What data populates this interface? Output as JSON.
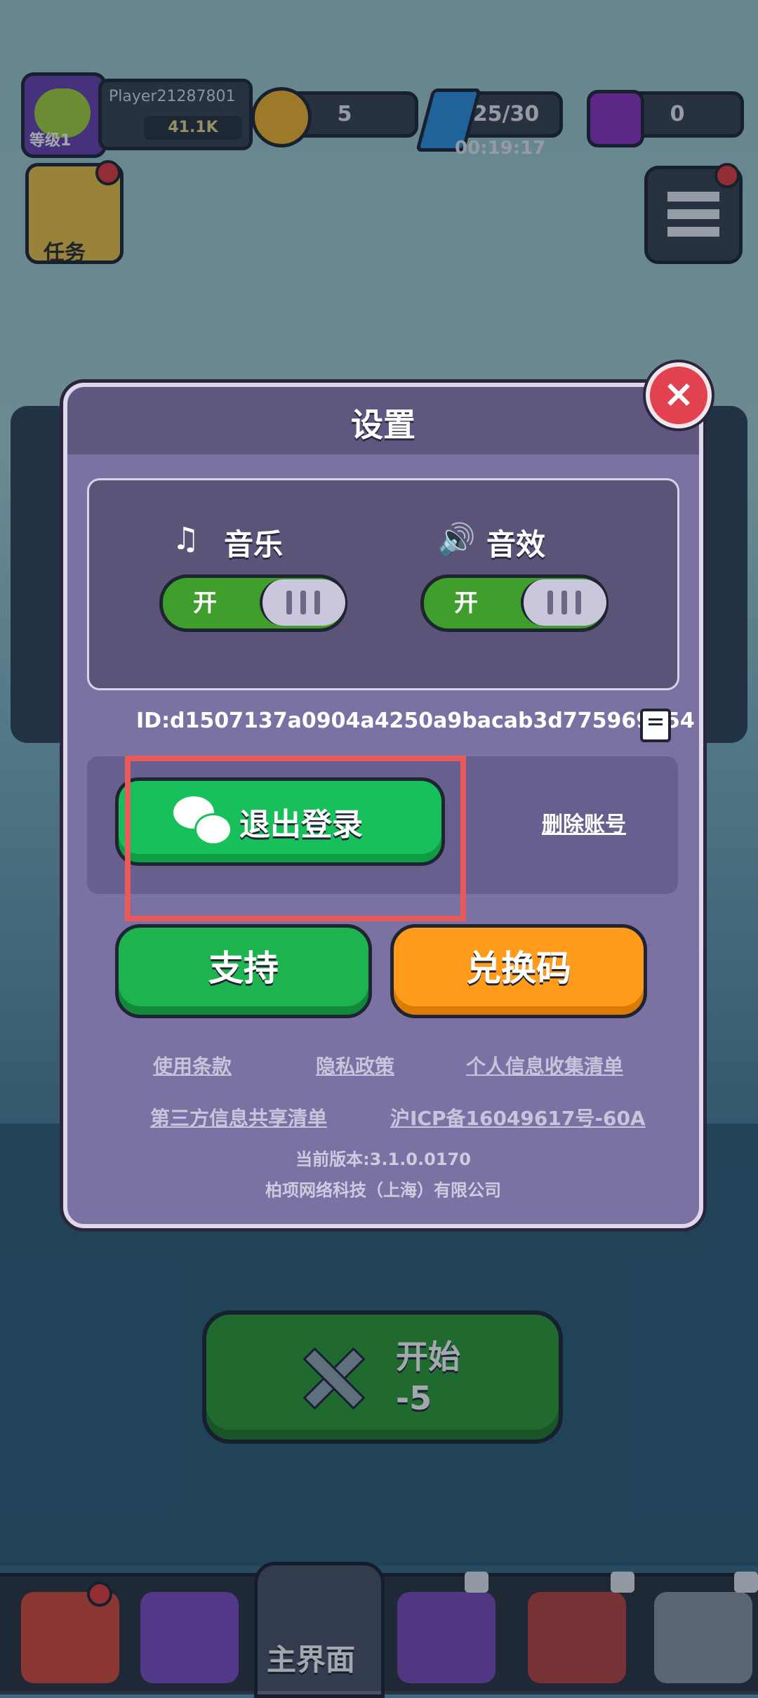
{
  "hud": {
    "level_label": "等级1",
    "player_name": "Player21287801",
    "power": "41.1K",
    "crowns": "5",
    "energy": "25/30",
    "energy_timer": "00:19:17",
    "gems": "0",
    "quest_label": "任务"
  },
  "dialog": {
    "title": "设置",
    "music_label": "音乐",
    "sfx_label": "音效",
    "music_toggle": "开",
    "sfx_toggle": "开",
    "account_id": "ID:d1507137a0904a4250a9bacab3d775969554",
    "logout_label": "退出登录",
    "delete_account": "删除账号",
    "support_label": "支持",
    "redeem_label": "兑换码",
    "links": {
      "terms": "使用条款",
      "privacy": "隐私政策",
      "personal_info": "个人信息收集清单",
      "third_party": "第三方信息共享清单",
      "icp": "沪ICP备16049617号-60A"
    },
    "version": "当前版本:3.1.0.0170",
    "company": "柏项网络科技（上海）有限公司"
  },
  "start": {
    "label": "开始",
    "cost": "-5"
  },
  "nav": {
    "home_label": "主界面"
  },
  "colors": {
    "dialog_bg": "#7b71a2",
    "logout_green": "#18c05b",
    "redeem_orange": "#ff9a1a",
    "highlight": "#e85b5b"
  }
}
